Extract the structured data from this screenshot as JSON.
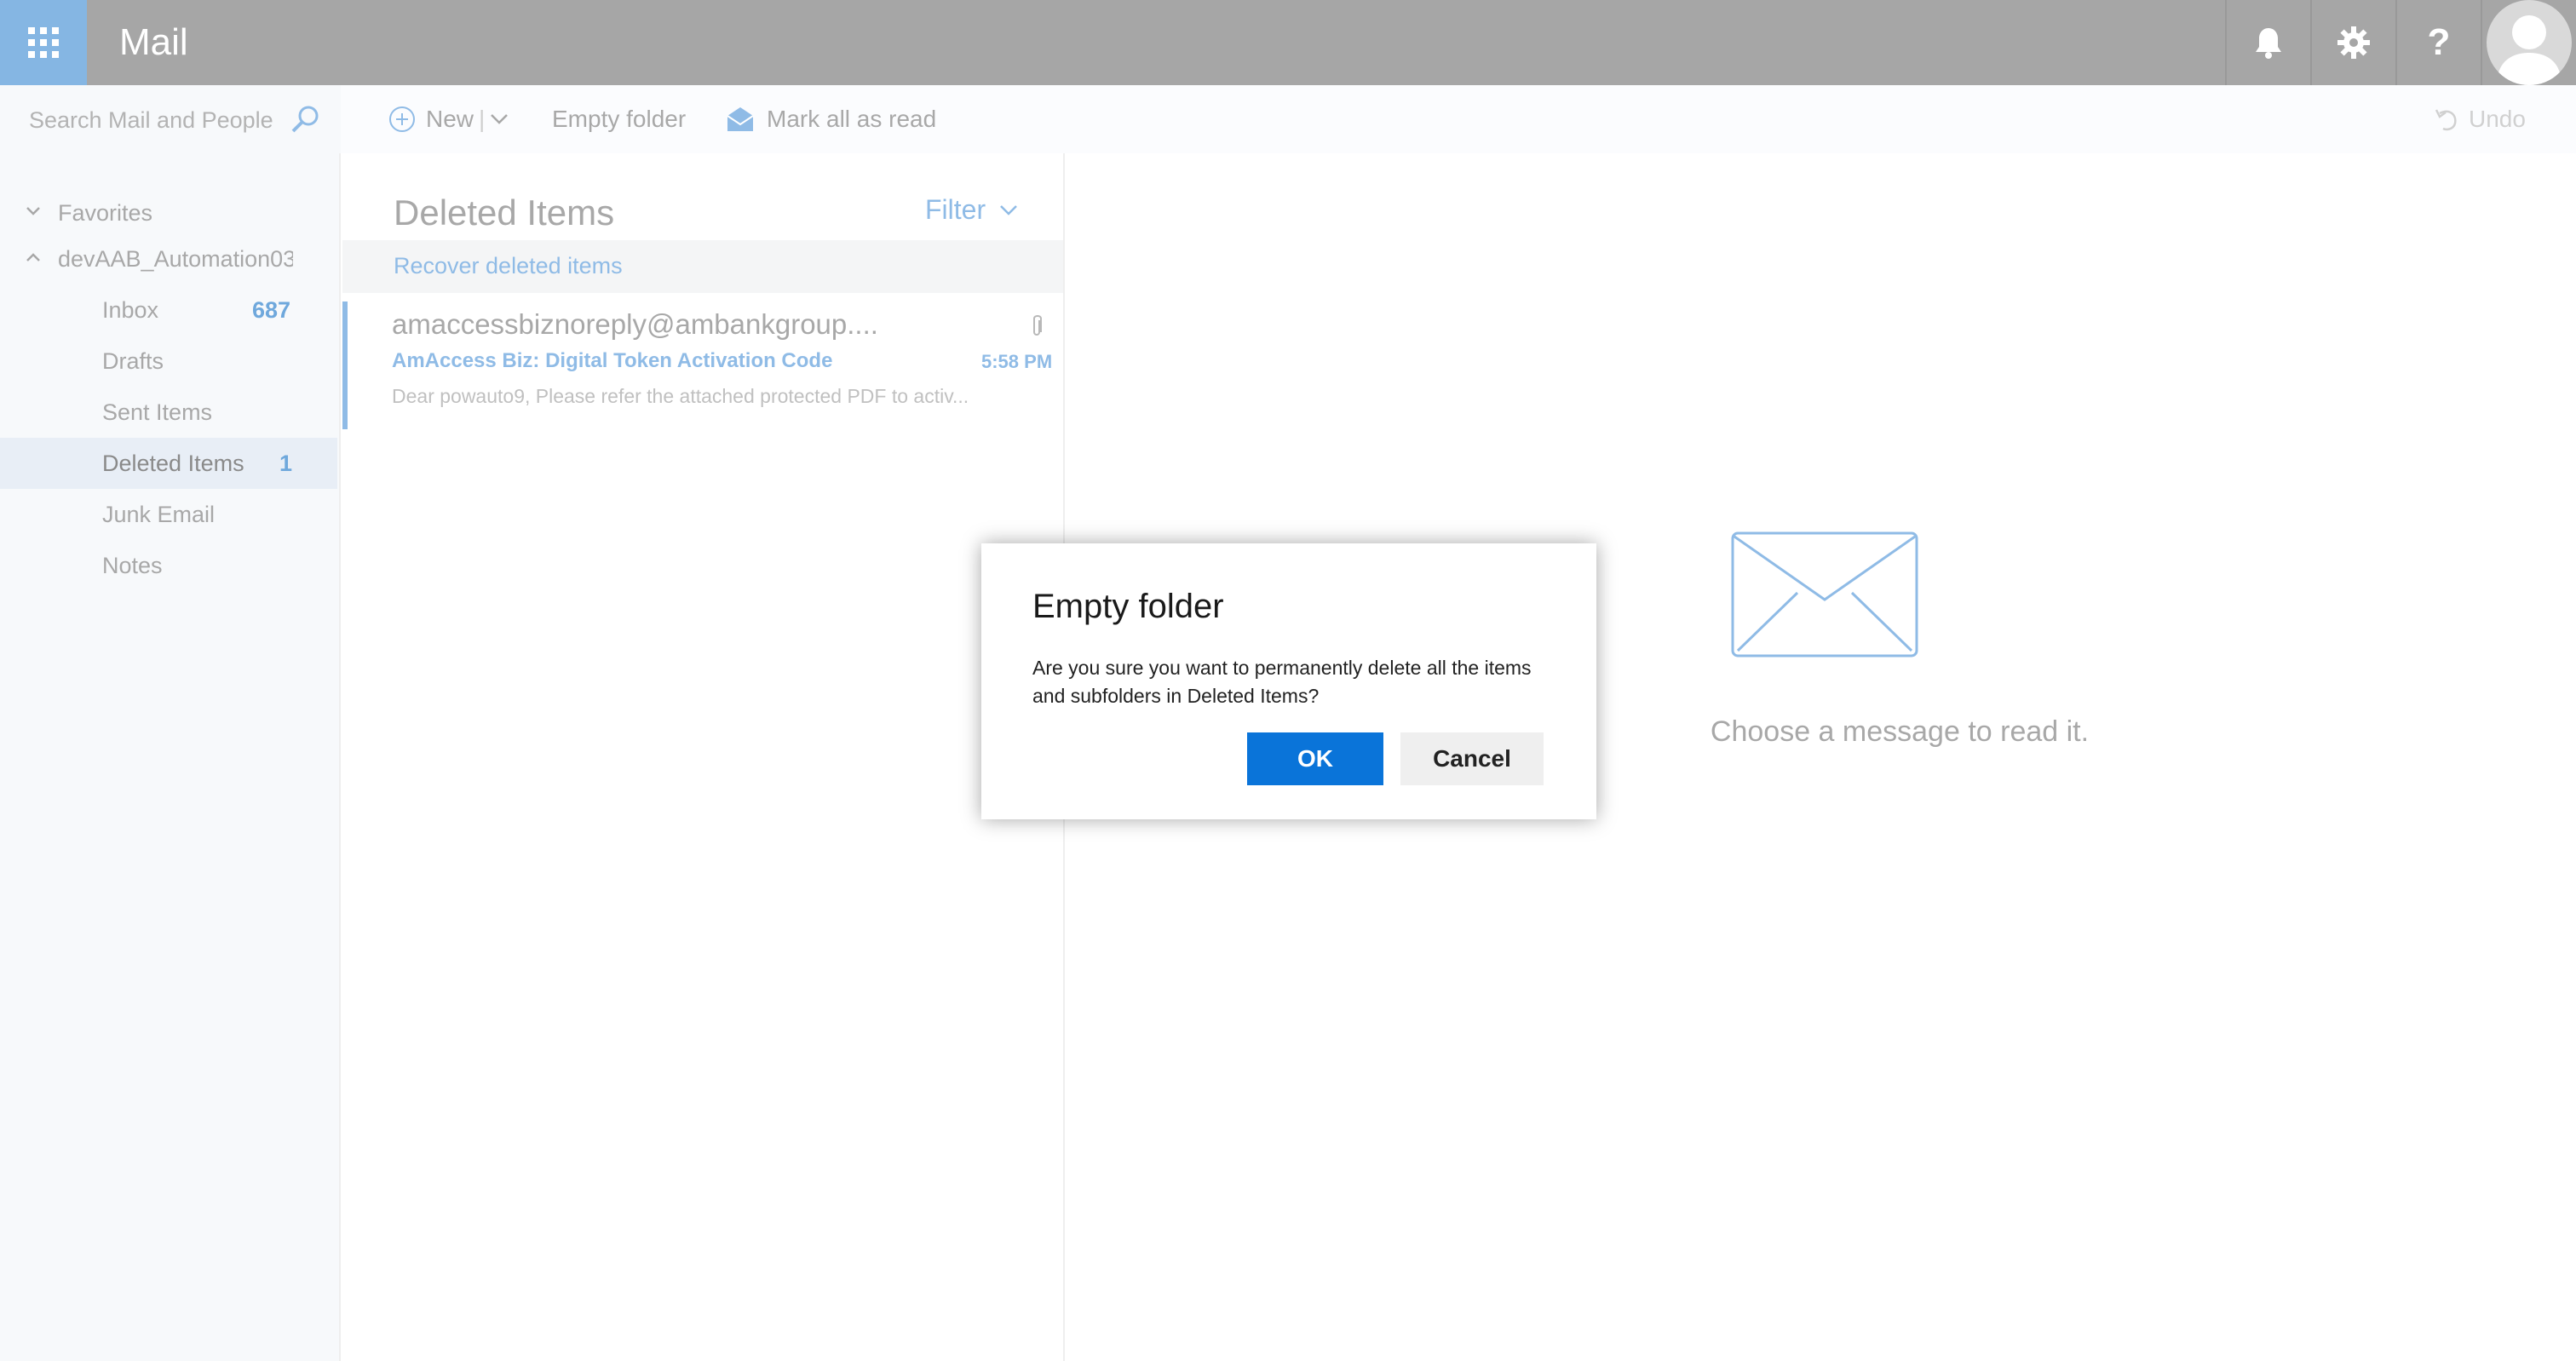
{
  "header": {
    "app_title": "Mail",
    "help_glyph": "?",
    "icons": [
      "app-launcher-icon",
      "bell-icon",
      "gear-icon",
      "help-icon",
      "avatar"
    ]
  },
  "command_bar": {
    "search_placeholder": "Search Mail and People",
    "new_label": "New",
    "empty_folder_label": "Empty folder",
    "mark_all_read_label": "Mark all as read",
    "undo_label": "Undo"
  },
  "sidebar": {
    "favorites_label": "Favorites",
    "account_label": "devAAB_Automation03",
    "folders": [
      {
        "label": "Inbox",
        "count": "687"
      },
      {
        "label": "Drafts",
        "count": ""
      },
      {
        "label": "Sent Items",
        "count": ""
      },
      {
        "label": "Deleted Items",
        "count": "1"
      },
      {
        "label": "Junk Email",
        "count": ""
      },
      {
        "label": "Notes",
        "count": ""
      }
    ]
  },
  "message_list": {
    "folder_title": "Deleted Items",
    "filter_label": "Filter",
    "recover_label": "Recover deleted items",
    "messages": [
      {
        "from": "amaccessbiznoreply@ambankgroup....",
        "subject": "AmAccess Biz: Digital Token Activation Code",
        "time": "5:58 PM",
        "preview": "Dear powauto9,   Please refer the attached protected PDF to activ..."
      }
    ]
  },
  "reading_pane": {
    "empty_text": "Choose a message to read it."
  },
  "dialog": {
    "title": "Empty folder",
    "body": "Are you sure you want to permanently delete all the items and subfolders in Deleted Items?",
    "ok_label": "OK",
    "cancel_label": "Cancel"
  },
  "colors": {
    "topbar": "#a6a6a6",
    "launcher": "#85b6e3",
    "accent": "#0a74d9",
    "link": "#8fbbe6"
  }
}
